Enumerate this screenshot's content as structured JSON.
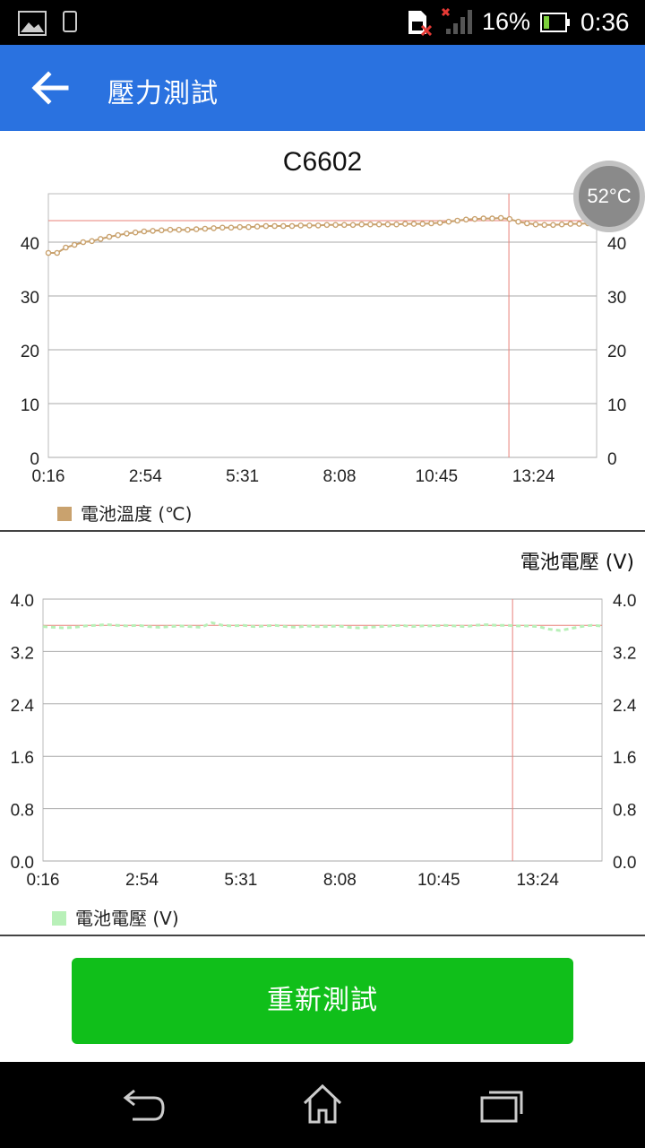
{
  "status_bar": {
    "battery_percent": "16%",
    "time": "0:36"
  },
  "app_bar": {
    "title": "壓力測試",
    "back_icon": "arrow-left-icon"
  },
  "temp_chart": {
    "title": "C6602",
    "badge": "52°C",
    "legend": "電池溫度 (℃)",
    "color": "#c9a26e",
    "chart_data": {
      "type": "line",
      "title": "C6602",
      "x_tick_labels": [
        "0:16",
        "2:54",
        "5:31",
        "8:08",
        "10:45",
        "13:24"
      ],
      "y_ticks": [
        "0",
        "10",
        "20",
        "30",
        "40"
      ],
      "ylim": [
        0,
        49
      ],
      "reference_line": 44,
      "cursor_x_fraction": 0.84,
      "series": [
        {
          "name": "電池溫度 (℃)",
          "values": [
            38,
            38,
            39,
            39.5,
            40,
            40.2,
            40.6,
            41,
            41.3,
            41.6,
            41.8,
            42,
            42.1,
            42.2,
            42.3,
            42.3,
            42.3,
            42.4,
            42.5,
            42.6,
            42.7,
            42.7,
            42.8,
            42.8,
            42.9,
            43,
            43,
            43,
            43,
            43.1,
            43.1,
            43.1,
            43.2,
            43.2,
            43.2,
            43.2,
            43.3,
            43.3,
            43.3,
            43.3,
            43.3,
            43.4,
            43.4,
            43.4,
            43.5,
            43.6,
            43.8,
            44,
            44.2,
            44.3,
            44.4,
            44.4,
            44.5,
            44.3,
            43.8,
            43.5,
            43.3,
            43.2,
            43.2,
            43.3,
            43.4,
            43.4,
            43.5,
            43.2
          ]
        }
      ]
    }
  },
  "volt_chart": {
    "title": "電池電壓 (V)",
    "legend": "電池電壓 (V)",
    "color": "#b8f0b8",
    "chart_data": {
      "type": "line",
      "title": "電池電壓 (V)",
      "x_tick_labels": [
        "0:16",
        "2:54",
        "5:31",
        "8:08",
        "10:45",
        "13:24"
      ],
      "y_ticks": [
        "0.0",
        "0.8",
        "1.6",
        "2.4",
        "3.2",
        "4.0"
      ],
      "ylim": [
        0,
        4.0
      ],
      "reference_line": 3.6,
      "cursor_x_fraction": 0.84,
      "series": [
        {
          "name": "電池電壓 (V)",
          "values": [
            3.58,
            3.57,
            3.56,
            3.57,
            3.59,
            3.6,
            3.61,
            3.6,
            3.59,
            3.6,
            3.58,
            3.57,
            3.58,
            3.59,
            3.58,
            3.57,
            3.64,
            3.6,
            3.59,
            3.6,
            3.58,
            3.59,
            3.6,
            3.58,
            3.57,
            3.59,
            3.58,
            3.58,
            3.59,
            3.57,
            3.56,
            3.57,
            3.58,
            3.59,
            3.6,
            3.58,
            3.59,
            3.59,
            3.6,
            3.59,
            3.58,
            3.6,
            3.61,
            3.6,
            3.6,
            3.59,
            3.59,
            3.58,
            3.54,
            3.52,
            3.55,
            3.58,
            3.6,
            3.59
          ]
        }
      ]
    }
  },
  "button": {
    "label": "重新測試"
  }
}
